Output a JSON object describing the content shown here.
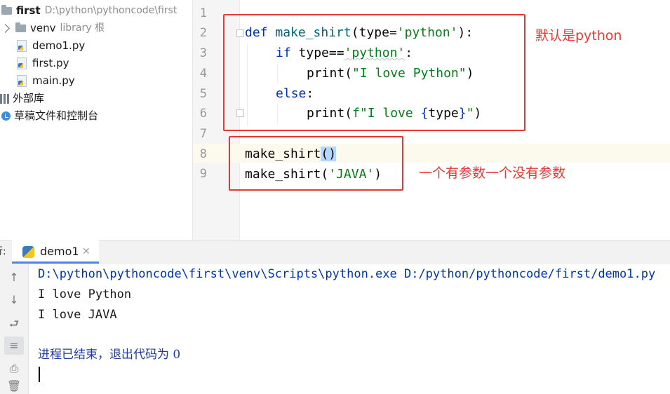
{
  "project_tree": {
    "root": {
      "name": "first",
      "path": "D:\\python\\pythoncode\\first"
    },
    "venv": {
      "name": "venv",
      "note": "library 根"
    },
    "files": [
      "demo1.py",
      "first.py",
      "main.py"
    ],
    "external_libs": "外部库",
    "scratches": "草稿文件和控制台"
  },
  "editor": {
    "line_numbers": [
      "1",
      "2",
      "3",
      "4",
      "5",
      "6",
      "7",
      "8",
      "9"
    ],
    "lines": {
      "l2": {
        "kw": "def",
        "name": "make_shirt",
        "open": "(",
        "param": "type",
        "eq": "=",
        "default": "'python'",
        "close": "):"
      },
      "l3": {
        "kw": "if",
        "expr": "type==",
        "str": "'python'",
        "colon": ":"
      },
      "l4": {
        "fn": "print",
        "open": "(",
        "str": "\"I love Python\"",
        "close": ")"
      },
      "l5": {
        "kw": "else",
        "colon": ":"
      },
      "l6": {
        "fn": "print",
        "open": "(",
        "str1": "f\"I love ",
        "brace_open": "{",
        "var": "type",
        "brace_close": "}",
        "str2": "\"",
        "close": ")"
      },
      "l8": {
        "name": "make_shirt",
        "parens": "()"
      },
      "l9": {
        "name": "make_shirt",
        "open": "(",
        "str": "'JAVA'",
        "close": ")"
      }
    }
  },
  "annotations": {
    "default_note": "默认是python",
    "call_note": "一个有参数一个没有参数",
    "color": "#e53935"
  },
  "run_panel": {
    "prefix": "行:",
    "tab_label": "demo1",
    "tab_close": "✕",
    "toolbar": [
      "↑",
      "↓",
      "⮐",
      "≡",
      "⎙",
      "🗑"
    ],
    "console": {
      "command": "D:\\python\\pythoncode\\first\\venv\\Scripts\\python.exe D:/python/pythoncode/first/demo1.py",
      "output": [
        "I love Python",
        "I love JAVA"
      ],
      "exit_message": "进程已结束，退出代码为 0"
    }
  }
}
